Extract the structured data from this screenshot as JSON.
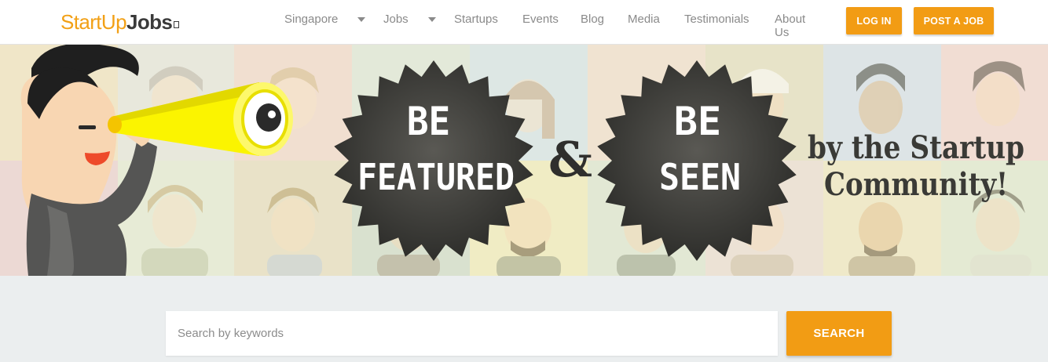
{
  "logo": {
    "part1": "StartUp",
    "part2": "Jobs"
  },
  "nav": {
    "location": "Singapore",
    "jobs": "Jobs",
    "startups": "Startups",
    "events": "Events",
    "blog": "Blog",
    "media": "Media",
    "testimonials": "Testimonials",
    "about": "About Us",
    "login": "LOG IN",
    "post_job": "POST A JOB"
  },
  "banner": {
    "badge1_line1": "BE",
    "badge1_line2": "FEATURED",
    "ampersand": "&",
    "badge2_line1": "BE",
    "badge2_line2": "SEEN",
    "tagline_line1": "by the Startup",
    "tagline_line2": "Community!"
  },
  "search": {
    "placeholder": "Search by keywords",
    "button_label": "SEARCH"
  },
  "colors": {
    "accent": "#f29c14",
    "nav_text": "#8a8a8a",
    "search_bg": "#ebeeef",
    "badge_dark": "#3f3f3c"
  }
}
